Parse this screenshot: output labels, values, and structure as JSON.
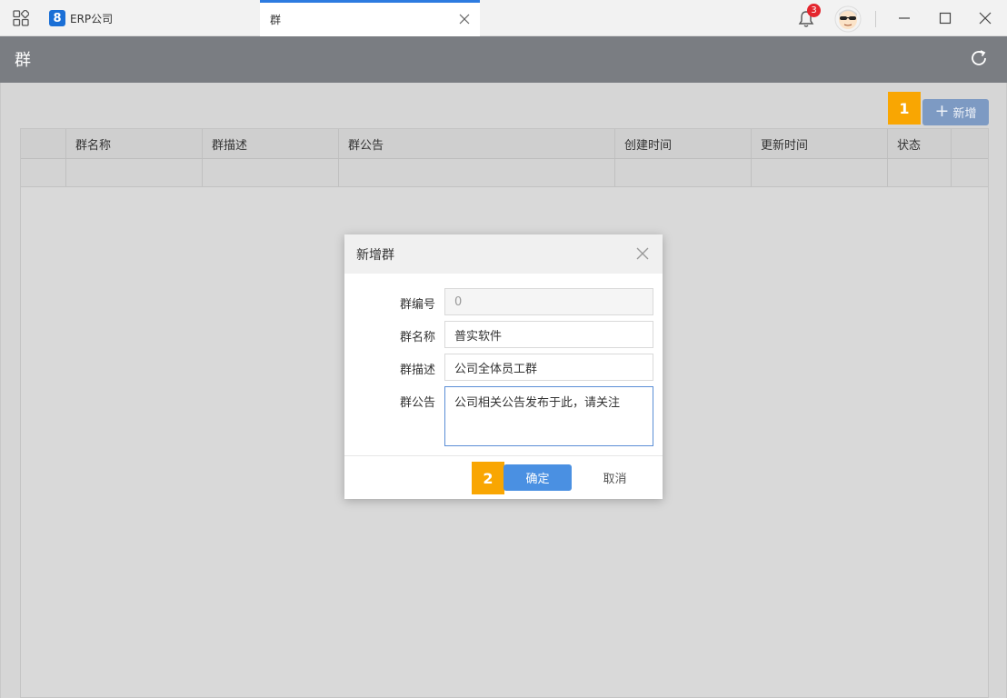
{
  "titlebar": {
    "tabs": [
      {
        "label": "ERP公司",
        "logo": "8"
      },
      {
        "label": "群"
      }
    ],
    "notifications": {
      "count": "3"
    }
  },
  "header": {
    "title": "群"
  },
  "toolbar": {
    "add_label": "新增"
  },
  "guides": [
    "1",
    "2"
  ],
  "grid": {
    "columns": [
      "群名称",
      "群描述",
      "群公告",
      "创建时间",
      "更新时间",
      "状态"
    ]
  },
  "dialog": {
    "title": "新增群",
    "fields": [
      {
        "label": "群编号",
        "value": "0"
      },
      {
        "label": "群名称",
        "value": "普实软件"
      },
      {
        "label": "群描述",
        "value": "公司全体员工群"
      },
      {
        "label": "群公告",
        "value": "公司相关公告发布于此，请关注"
      }
    ],
    "ok_label": "确定",
    "cancel_label": "取消"
  },
  "colors": {
    "accent": "#4a90e2",
    "guide": "#f9a602",
    "header": "#7a7d82"
  }
}
